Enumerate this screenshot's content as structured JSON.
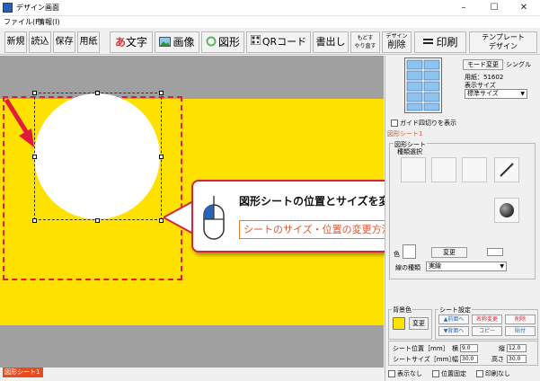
{
  "window": {
    "title": "デザイン画面",
    "minimize": "–",
    "maximize": "☐",
    "close": "✕"
  },
  "menu": {
    "items": [
      "ファイル(F)",
      "情報(I)"
    ]
  },
  "toolbar": {
    "new": "新規",
    "open": "読込",
    "save": "保存",
    "paper": "用紙",
    "text": "文字",
    "text_glyph": "あ",
    "image": "画像",
    "shape": "図形",
    "qr": "QRコード",
    "export": "書出し",
    "undo_top": "もどす",
    "undo_bottom": "やり直す",
    "delete_top": "デザイン",
    "delete": "削除",
    "print": "印刷",
    "template_top": "テンプレート",
    "template_bottom": "デザイン"
  },
  "callout": {
    "title": "図形シートの位置とサイズを変更",
    "link": "シートのサイズ・位置の変更方法はこちら"
  },
  "status": {
    "tab": "図形シート1"
  },
  "panel": {
    "mode_change": "モード変更",
    "mode_single": "シングル",
    "paper_label": "用紙：51602",
    "view_size_label": "表示サイズ",
    "view_size": "標準サイズ",
    "guide_checkbox": "ガイド四切りを表示",
    "sheet_tab": "図形シート1",
    "shape_sheet_group": "図形シート",
    "kind_label": "種類選択",
    "color_label": "色",
    "change_btn": "変更",
    "line_type_label": "線の種類",
    "line_type": "実線",
    "bg_group": "背景色",
    "bg_change": "変更",
    "sheet_settings_group": "シート設定",
    "btn_front": "▲前面へ",
    "btn_rename": "名称変更",
    "btn_delete": "削除",
    "btn_back": "▼背面へ",
    "btn_copy": "コピー",
    "btn_paste": "貼付",
    "pos_label": "シート位置［mm］",
    "pos_x_label": "横",
    "pos_x": "9.0",
    "pos_y_label": "縦",
    "pos_y": "12.0",
    "size_label": "シートサイズ［mm］",
    "width_label": "幅",
    "width": "30.0",
    "height_label": "高さ",
    "height": "30.0",
    "chk_hide": "表示なし",
    "chk_lock": "位置固定",
    "chk_noprint": "印刷なし"
  },
  "colors": {
    "canvas_bg": "#a0a0a0",
    "paper": "#ffe100",
    "accent_red": "#e31b3b",
    "link_orange": "#e0542a",
    "tab_orange": "#e64c1e"
  }
}
